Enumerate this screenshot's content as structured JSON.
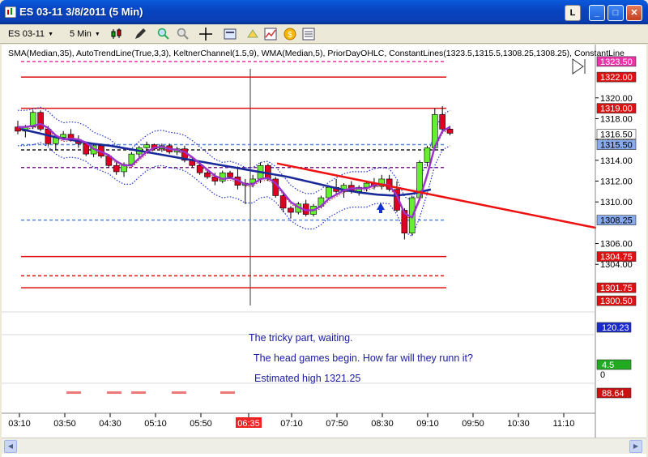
{
  "window": {
    "title": "ES 03-11  3/8/2011 (5 Min)",
    "btn_l": "L",
    "btn_min": "_",
    "btn_max": "□",
    "btn_close": "✕"
  },
  "toolbar": {
    "instrument": "ES 03-11",
    "interval": "5 Min",
    "icons": [
      "candlestick-icon",
      "pencil-icon",
      "zoom-in-icon",
      "zoom-out-icon",
      "crosshair-icon",
      "properties-icon",
      "strategy-icon",
      "data-box-icon",
      "signal-icon",
      "order-icon"
    ]
  },
  "indicator_label": "SMA(Median,35), AutoTrendLine(True,3,3), KeltnerChannel(1.5,9), WMA(Median,5), PriorDayOHLC, ConstantLines(1323.5,1315.5,1308.25,1308.25), ConstantLine",
  "annotations": {
    "line1": "The tricky part, waiting.",
    "line2": "The head games begin. How far will they runn it?",
    "line3": "Estimated high 1321.25"
  },
  "colors": {
    "up_candle": "#66ee33",
    "down_candle": "#dd0022",
    "annotation_text": "#1a1aa0",
    "trendline": "#ee1111",
    "sma": "#1a2a99",
    "wma": "#9933cc",
    "keltner": "#2233cc"
  },
  "chart_data": {
    "type": "candlestick",
    "ylim": [
      1299.5,
      1324.5
    ],
    "y_ticks": [
      "1320.00",
      "1318.00",
      "1316.00",
      "1314.00",
      "1312.00",
      "1310.00",
      "1306.00",
      "1304.00"
    ],
    "x_ticks": [
      "03:10",
      "03:50",
      "04:30",
      "05:10",
      "05:50",
      "06:35",
      "07:10",
      "07:50",
      "08:30",
      "09:10",
      "09:50",
      "10:30",
      "11:10"
    ],
    "crosshair_time": "06:35",
    "price_tags": [
      {
        "value": 1323.5,
        "label": "1323.50",
        "bg": "#ee33aa"
      },
      {
        "value": 1322.0,
        "label": "1322.00",
        "bg": "#dd1111"
      },
      {
        "value": 1319.0,
        "label": "1319.00",
        "bg": "#dd1111"
      },
      {
        "value": 1316.5,
        "label": "1316.50",
        "bg": "#ffffff"
      },
      {
        "value": 1315.5,
        "label": "1315.50",
        "bg": "#88aaee"
      },
      {
        "value": 1308.25,
        "label": "1308.25",
        "bg": "#88aaee"
      },
      {
        "value": 1304.75,
        "label": "1304.75",
        "bg": "#dd1111"
      },
      {
        "value": 1301.75,
        "label": "1301.75",
        "bg": "#dd1111"
      },
      {
        "value": 1300.5,
        "label": "1300.50",
        "bg": "#dd1111"
      }
    ],
    "constant_lines": [
      {
        "value": 1323.5,
        "color": "#ee33aa",
        "dash": true
      },
      {
        "value": 1322.0,
        "color": "#dd1111",
        "dash": false
      },
      {
        "value": 1319.0,
        "color": "#dd1111",
        "dash": false
      },
      {
        "value": 1315.5,
        "color": "#5588dd",
        "dash": true
      },
      {
        "value": 1315.0,
        "color": "#222222",
        "dash": true
      },
      {
        "value": 1313.3,
        "color": "#772288",
        "dash": true
      },
      {
        "value": 1308.25,
        "color": "#5588dd",
        "dash": true
      },
      {
        "value": 1304.75,
        "color": "#dd1111",
        "dash": false
      },
      {
        "value": 1302.9,
        "color": "#dd1111",
        "dash": true
      },
      {
        "value": 1301.75,
        "color": "#dd1111",
        "dash": false
      }
    ],
    "candles": [
      [
        1317.2,
        1317.8,
        1316.5,
        1316.8
      ],
      [
        1316.8,
        1317.4,
        1316.2,
        1317.2
      ],
      [
        1317.2,
        1318.8,
        1317.0,
        1318.6
      ],
      [
        1318.6,
        1318.8,
        1316.8,
        1317.0
      ],
      [
        1317.0,
        1317.3,
        1315.4,
        1315.6
      ],
      [
        1315.6,
        1316.4,
        1315.0,
        1316.2
      ],
      [
        1316.2,
        1316.8,
        1315.9,
        1316.5
      ],
      [
        1316.5,
        1317.0,
        1315.8,
        1316.0
      ],
      [
        1316.0,
        1316.4,
        1315.2,
        1315.6
      ],
      [
        1315.6,
        1315.8,
        1314.4,
        1314.6
      ],
      [
        1314.6,
        1315.6,
        1314.3,
        1315.4
      ],
      [
        1315.4,
        1315.6,
        1314.2,
        1314.4
      ],
      [
        1314.4,
        1314.6,
        1313.3,
        1313.5
      ],
      [
        1313.5,
        1313.8,
        1312.6,
        1312.9
      ],
      [
        1312.9,
        1313.8,
        1312.4,
        1313.6
      ],
      [
        1313.6,
        1314.8,
        1313.4,
        1314.6
      ],
      [
        1314.6,
        1315.4,
        1314.3,
        1315.2
      ],
      [
        1315.2,
        1315.8,
        1314.9,
        1315.5
      ],
      [
        1315.5,
        1315.6,
        1315.0,
        1315.1
      ],
      [
        1315.1,
        1315.6,
        1314.8,
        1315.4
      ],
      [
        1315.4,
        1315.6,
        1314.6,
        1314.8
      ],
      [
        1314.8,
        1315.3,
        1314.5,
        1315.1
      ],
      [
        1315.1,
        1315.4,
        1313.8,
        1314.0
      ],
      [
        1314.0,
        1314.2,
        1313.3,
        1313.5
      ],
      [
        1313.5,
        1313.8,
        1312.6,
        1312.8
      ],
      [
        1312.8,
        1313.2,
        1312.2,
        1312.4
      ],
      [
        1312.4,
        1312.8,
        1311.6,
        1312.0
      ],
      [
        1312.0,
        1313.0,
        1311.8,
        1312.8
      ],
      [
        1312.8,
        1313.0,
        1312.2,
        1312.4
      ],
      [
        1312.4,
        1313.4,
        1311.2,
        1311.6
      ],
      [
        1311.6,
        1312.2,
        1309.8,
        1311.8
      ],
      [
        1311.8,
        1312.6,
        1311.4,
        1312.2
      ],
      [
        1312.2,
        1313.8,
        1311.8,
        1313.5
      ],
      [
        1313.5,
        1313.7,
        1312.0,
        1312.2
      ],
      [
        1312.2,
        1312.4,
        1310.4,
        1310.6
      ],
      [
        1310.6,
        1310.8,
        1309.0,
        1309.4
      ],
      [
        1309.4,
        1309.6,
        1308.4,
        1309.0
      ],
      [
        1309.0,
        1310.0,
        1308.8,
        1309.8
      ],
      [
        1309.8,
        1310.2,
        1308.6,
        1308.8
      ],
      [
        1308.8,
        1309.8,
        1308.6,
        1309.6
      ],
      [
        1309.6,
        1310.6,
        1309.4,
        1310.4
      ],
      [
        1310.4,
        1311.6,
        1310.2,
        1311.4
      ],
      [
        1311.4,
        1312.2,
        1310.8,
        1311.0
      ],
      [
        1311.0,
        1311.8,
        1310.4,
        1311.6
      ],
      [
        1311.6,
        1312.0,
        1310.8,
        1311.0
      ],
      [
        1311.0,
        1311.6,
        1310.6,
        1311.4
      ],
      [
        1311.4,
        1312.0,
        1311.0,
        1311.8
      ],
      [
        1311.8,
        1312.3,
        1311.2,
        1311.5
      ],
      [
        1311.5,
        1312.6,
        1311.2,
        1312.2
      ],
      [
        1312.2,
        1312.6,
        1311.0,
        1311.2
      ],
      [
        1311.2,
        1312.0,
        1309.0,
        1309.2
      ],
      [
        1309.2,
        1309.4,
        1306.4,
        1307.0
      ],
      [
        1307.0,
        1310.6,
        1306.8,
        1310.4
      ],
      [
        1310.4,
        1314.0,
        1310.2,
        1313.8
      ],
      [
        1313.8,
        1315.4,
        1313.4,
        1315.2
      ],
      [
        1315.2,
        1319.0,
        1315.0,
        1318.4
      ],
      [
        1318.4,
        1319.2,
        1316.6,
        1317.0
      ],
      [
        1317.0,
        1317.3,
        1316.4,
        1316.6
      ]
    ],
    "sma_series": [
      1317.0,
      1316.6,
      1316.2,
      1315.9,
      1315.6,
      1315.4,
      1315.1,
      1314.8,
      1314.5,
      1314.2,
      1313.9,
      1313.6,
      1313.3,
      1313.0,
      1312.7,
      1312.4,
      1312.0,
      1311.6,
      1311.2,
      1310.9,
      1310.7,
      1310.6,
      1310.8,
      1311.2
    ],
    "wma_series": [
      1317.2,
      1317.2,
      1317.3,
      1317.5,
      1317.1,
      1316.4,
      1316.0,
      1316.1,
      1316.0,
      1315.7,
      1315.1,
      1314.8,
      1314.5,
      1313.9,
      1313.5,
      1313.5,
      1314.2,
      1314.8,
      1315.2,
      1315.3,
      1315.1,
      1315.0,
      1314.8,
      1314.3,
      1313.7,
      1313.1,
      1312.5,
      1312.2,
      1312.3,
      1312.1,
      1311.7,
      1311.7,
      1312.2,
      1312.3,
      1311.8,
      1310.9,
      1310.0,
      1309.5,
      1309.2,
      1309.2,
      1309.6,
      1310.3,
      1310.7,
      1311.1,
      1311.3,
      1311.3,
      1311.3,
      1311.6,
      1311.7,
      1311.6,
      1310.6,
      1308.9,
      1308.5,
      1310.3,
      1312.6,
      1315.3,
      1316.8,
      1317.2
    ],
    "trendline": [
      [
        1313.7,
        30
      ],
      [
        1307.5,
        100
      ]
    ],
    "sub_panels": [
      {
        "label": "120.23",
        "bg": "#1a2acc",
        "zero": ""
      },
      {
        "label": "4.5",
        "bg": "#22aa22",
        "zero": "0"
      },
      {
        "label": "88.64",
        "bg": "#cc1111",
        "zero": ""
      }
    ]
  }
}
